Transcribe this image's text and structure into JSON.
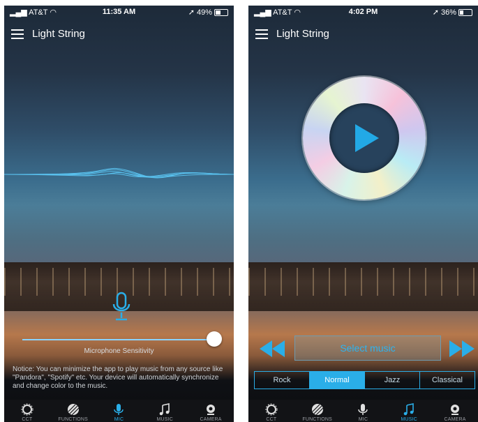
{
  "left": {
    "status": {
      "carrier": "AT&T",
      "time": "11:35 AM",
      "battery": "49%"
    },
    "appbar": {
      "title": "Light String"
    },
    "slider": {
      "label": "Microphone Sensitivity",
      "value_fraction": 1.0
    },
    "notice": "Notice: You can minimize the app to play music from any source like \"Pandora\", \"Spotify\" etc. Your device will automatically synchronize and change color to the music.",
    "tabs": [
      {
        "label": "CCT",
        "icon": "aperture-icon"
      },
      {
        "label": "FUNCTIONS",
        "icon": "hatched-ball-icon"
      },
      {
        "label": "MIC",
        "icon": "microphone-icon"
      },
      {
        "label": "MUSIC",
        "icon": "music-note-icon"
      },
      {
        "label": "CAMERA",
        "icon": "camera-icon"
      }
    ],
    "active_tab": "MIC"
  },
  "right": {
    "status": {
      "carrier": "AT&T",
      "time": "4:02 PM",
      "battery": "36%"
    },
    "appbar": {
      "title": "Light String"
    },
    "select_music": "Select music",
    "genres": [
      "Rock",
      "Normal",
      "Jazz",
      "Classical"
    ],
    "selected_genre": "Normal",
    "tabs": [
      {
        "label": "CCT",
        "icon": "aperture-icon"
      },
      {
        "label": "FUNCTIONS",
        "icon": "hatched-ball-icon"
      },
      {
        "label": "MIC",
        "icon": "microphone-icon"
      },
      {
        "label": "MUSIC",
        "icon": "music-note-icon"
      },
      {
        "label": "CAMERA",
        "icon": "camera-icon"
      }
    ],
    "active_tab": "MUSIC"
  },
  "colors": {
    "accent": "#2aaee8",
    "tabbar": "#121316"
  }
}
